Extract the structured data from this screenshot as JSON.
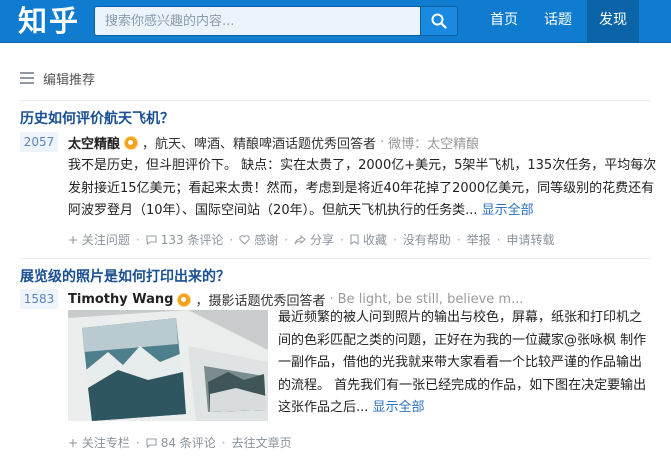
{
  "header": {
    "logo": "知乎",
    "search_placeholder": "搜索你感兴趣的内容...",
    "nav": [
      {
        "label": "首页",
        "active": false
      },
      {
        "label": "话题",
        "active": false
      },
      {
        "label": "发现",
        "active": true
      }
    ],
    "colors": {
      "bar": "#0f7ccf",
      "active_tab": "#0b63a8"
    }
  },
  "section": {
    "title": "编辑推荐",
    "icon": "list-icon"
  },
  "feed": [
    {
      "question": "历史如何评价航天飞机？",
      "votes": "2057",
      "author": "太空精酿",
      "bio": "，航天、啤酒、精酿啤酒话题优秀回答者",
      "source": "微博：太空精酿",
      "summary_lines": [
        "我不是历史，但斗胆评价下。 缺点：实在太贵了，2000亿+美元，5架半飞机，135次任务，平均每次",
        "发射接近15亿美元；看起来太贵！然而，考虑到是将近40年花掉了2000亿美元，同等级别的花费还有",
        "阿波罗登月（10年）、国际空间站（20年）。但航天飞机执行的任务类..."
      ],
      "more": "显示全部",
      "actions": {
        "follow": "+ 关注问题",
        "comments": "133 条评论",
        "thanks": "感谢",
        "share": "分享",
        "collect": "收藏",
        "unhelpful": "没有帮助",
        "report": "举报",
        "reprint": "申请转载"
      }
    },
    {
      "question": "展览级的照片是如何打印出来的？",
      "votes": "1583",
      "author": "Timothy Wang",
      "bio": "，摄影话题优秀回答者",
      "source": "Be light, be still, believe m...",
      "summary_lines": [
        "最近频繁的被人问到照片的输出与校色，屏幕，纸张和打印机之",
        "间的色彩匹配之类的问题，正好在为我的一位藏家@张咏枫 制作",
        "一副作品，借他的光我就来带大家看看一个比较严谨的作品输出",
        "的流程。 首先我们有一张已经完成的作品，如下图在决定要输出",
        "这张作品之后..."
      ],
      "more": "显示全部",
      "actions": {
        "follow": "+ 关注专栏",
        "comments": "84 条评论",
        "goto": "去往文章页"
      }
    }
  ]
}
